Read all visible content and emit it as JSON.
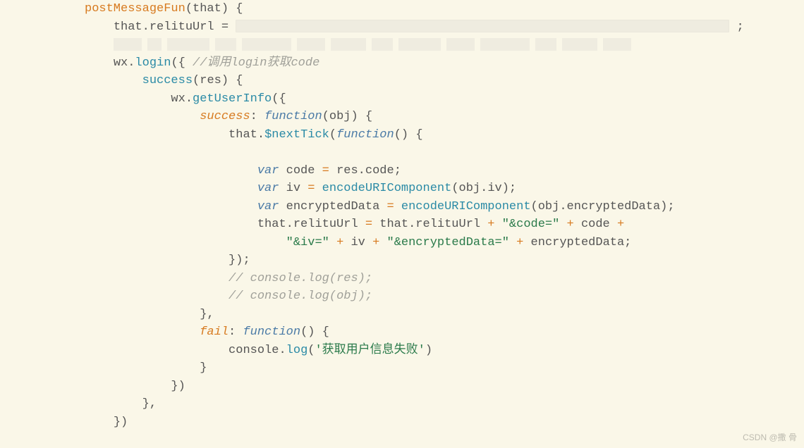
{
  "code": {
    "fn_def": "postMessageFun",
    "param_that": "that",
    "that_relituUrl": "that.relituUrl",
    "eq": " = ",
    "semi": ";",
    "wx": "wx",
    "login": "login",
    "cmt_login": "//调用login获取code",
    "success": "success",
    "res": "res",
    "getUserInfo": "getUserInfo",
    "success_key": "success",
    "function_kw": "function",
    "obj": "obj",
    "that": "that",
    "nextTick": "$nextTick",
    "var_kw": "var",
    "code_id": "code",
    "res_code": "res.code",
    "iv_id": "iv",
    "encodeURIComponent": "encodeURIComponent",
    "obj_iv": "obj.iv",
    "encryptedData_id": "encryptedData",
    "obj_encryptedData": "obj.encryptedData",
    "plus": " + ",
    "str_code": "\"&code=\"",
    "str_iv": "\"&iv=\"",
    "str_encdata": "\"&encryptedData=\"",
    "cmt_log_res": "// console.log(res);",
    "cmt_log_obj": "// console.log(obj);",
    "fail_key": "fail",
    "console": "console",
    "log": "log",
    "str_fail": "'获取用户信息失败'"
  },
  "watermark": "CSDN @撒 骨"
}
